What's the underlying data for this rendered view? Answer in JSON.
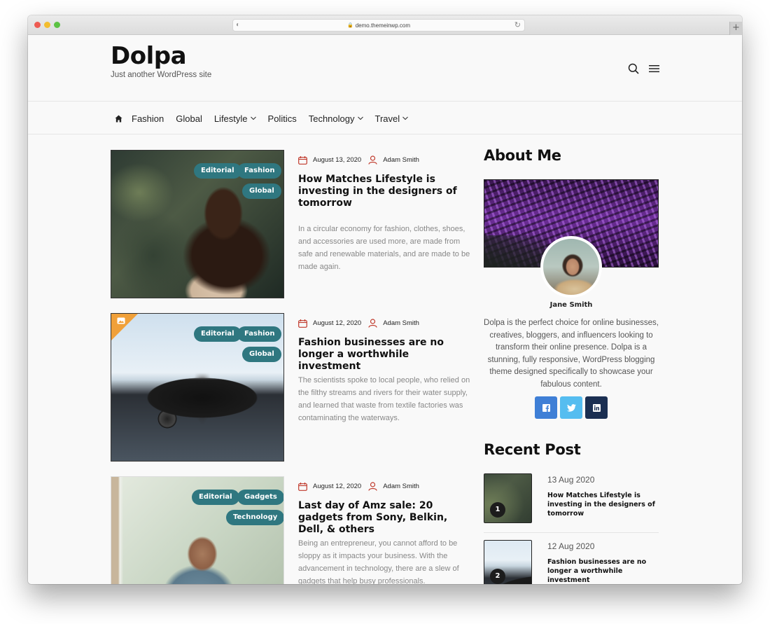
{
  "browser": {
    "url": "demo.themeinwp.com",
    "new_tab_label": "+"
  },
  "site": {
    "title": "Dolpa",
    "tagline": "Just another WordPress site"
  },
  "nav": {
    "items": [
      {
        "label": "Fashion",
        "has_dropdown": false
      },
      {
        "label": "Global",
        "has_dropdown": false
      },
      {
        "label": "Lifestyle",
        "has_dropdown": true
      },
      {
        "label": "Politics",
        "has_dropdown": false
      },
      {
        "label": "Technology",
        "has_dropdown": true
      },
      {
        "label": "Travel",
        "has_dropdown": true
      }
    ]
  },
  "posts": [
    {
      "tags": [
        "Editorial",
        "Fashion",
        "Global"
      ],
      "date": "August 13, 2020",
      "author": "Adam Smith",
      "title": "How Matches Lifestyle is investing in the designers of tomorrow",
      "excerpt": "In a circular economy for fashion, clothes, shoes, and accessories are used more, are made from safe and renewable materials, and are made to be made again."
    },
    {
      "tags": [
        "Editorial",
        "Fashion",
        "Global"
      ],
      "date": "August 12, 2020",
      "author": "Adam Smith",
      "title": "Fashion businesses are no longer a worthwhile investment",
      "excerpt": "The scientists spoke to local people, who relied on the filthy streams and rivers for their water supply, and learned that waste from textile factories was contaminating the waterways.",
      "format_icon": "gallery-icon"
    },
    {
      "tags": [
        "Editorial",
        "Gadgets",
        "Technology"
      ],
      "date": "August 12, 2020",
      "author": "Adam Smith",
      "title": "Last day of Amz sale: 20 gadgets from Sony, Belkin, Dell, & others",
      "excerpt": "Being an entrepreneur, you cannot afford to be sloppy as it impacts your business. With the advancement in technology, there are a slew of gadgets that help busy professionals."
    }
  ],
  "sidebar": {
    "about": {
      "title": "About Me",
      "name": "Jane Smith",
      "text": "Dolpa is the perfect choice for online businesses, creatives, bloggers, and influencers looking to transform their online presence. Dolpa is a stunning, fully responsive, WordPress blogging theme designed specifically to showcase your fabulous content.",
      "socials": [
        "facebook",
        "twitter",
        "linkedin"
      ]
    },
    "recent": {
      "title": "Recent Post",
      "items": [
        {
          "num": "1",
          "date": "13 Aug 2020",
          "title": "How Matches Lifestyle is investing in the designers of tomorrow"
        },
        {
          "num": "2",
          "date": "12 Aug 2020",
          "title": "Fashion businesses are no longer a worthwhile investment"
        }
      ]
    }
  },
  "colors": {
    "tag_bg": "#2f7780",
    "meta_icon": "#c0392b",
    "facebook": "#3f7fd6",
    "twitter": "#55bdf0",
    "linkedin": "#1b2f52",
    "gallery_corner": "#f0a039"
  }
}
